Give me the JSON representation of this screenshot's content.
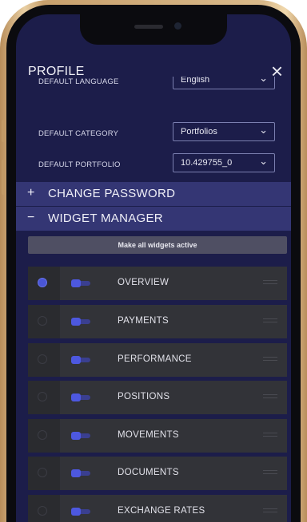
{
  "header": {
    "title": "PROFILE",
    "close_icon": "close-icon"
  },
  "settings": [
    {
      "label": "DEFAULT LANGUAGE",
      "value": "English"
    },
    {
      "label": "DEFAULT CATEGORY",
      "value": "Portfolios"
    },
    {
      "label": "DEFAULT PORTFOLIO",
      "value": "10.429755_0"
    }
  ],
  "sections": {
    "change_password": {
      "sign": "+",
      "label": "CHANGE PASSWORD"
    },
    "widget_manager": {
      "sign": "−",
      "label": "WIDGET MANAGER"
    }
  },
  "activate_button": "Make all widgets active",
  "widgets": [
    {
      "name": "OVERVIEW",
      "selected": true
    },
    {
      "name": "PAYMENTS",
      "selected": false
    },
    {
      "name": "PERFORMANCE",
      "selected": false
    },
    {
      "name": "POSITIONS",
      "selected": false
    },
    {
      "name": "MOVEMENTS",
      "selected": false
    },
    {
      "name": "DOCUMENTS",
      "selected": false
    },
    {
      "name": "EXCHANGE RATES",
      "selected": false
    }
  ],
  "colors": {
    "background": "#1c1d4a",
    "band": "#343674",
    "accent": "#4d58e0",
    "frame": "#d9b98a"
  }
}
